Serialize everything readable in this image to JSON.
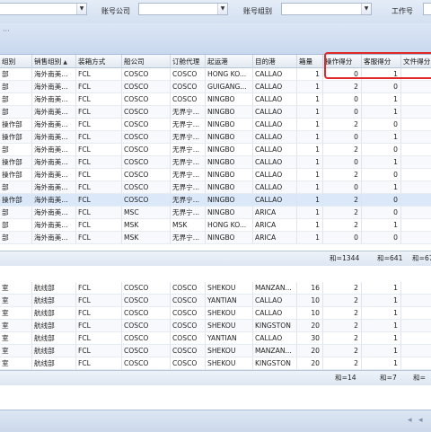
{
  "toolbar": {
    "label_account_company": "账号公司",
    "label_account_group": "账号组别",
    "label_work_no": "工作号",
    "input_values": [
      "",
      "",
      "",
      ""
    ],
    "dropdown_glyph": "▼"
  },
  "top_table": {
    "headers": [
      "组别",
      "销售组别",
      "装箱方式",
      "船公司",
      "订舱代理",
      "起运港",
      "目的港",
      "箱量",
      "操作得分",
      "客服得分",
      "文件得分"
    ],
    "sort_indicator": "▲",
    "rows": [
      [
        "部",
        "海外南美...",
        "FCL",
        "COSCO",
        "COSCO",
        "HONG KO...",
        "CALLAO",
        "1",
        "0",
        "1"
      ],
      [
        "部",
        "海外南美...",
        "FCL",
        "COSCO",
        "COSCO",
        "GUIGANG...",
        "CALLAO",
        "1",
        "2",
        "0"
      ],
      [
        "部",
        "海外南美...",
        "FCL",
        "COSCO",
        "COSCO",
        "NINGBO",
        "CALLAO",
        "1",
        "0",
        "1"
      ],
      [
        "部",
        "海外南美...",
        "FCL",
        "COSCO",
        "无界宁...",
        "NINGBO",
        "CALLAO",
        "1",
        "0",
        "1"
      ],
      [
        "操作部",
        "海外南美...",
        "FCL",
        "COSCO",
        "无界宁...",
        "NINGBO",
        "CALLAO",
        "1",
        "2",
        "0"
      ],
      [
        "操作部",
        "海外南美...",
        "FCL",
        "COSCO",
        "无界宁...",
        "NINGBO",
        "CALLAO",
        "1",
        "0",
        "1"
      ],
      [
        "部",
        "海外南美...",
        "FCL",
        "COSCO",
        "无界宁...",
        "NINGBO",
        "CALLAO",
        "1",
        "2",
        "0"
      ],
      [
        "操作部",
        "海外南美...",
        "FCL",
        "COSCO",
        "无界宁...",
        "NINGBO",
        "CALLAO",
        "1",
        "0",
        "1"
      ],
      [
        "操作部",
        "海外南美...",
        "FCL",
        "COSCO",
        "无界宁...",
        "NINGBO",
        "CALLAO",
        "1",
        "2",
        "0"
      ],
      [
        "部",
        "海外南美...",
        "FCL",
        "COSCO",
        "无界宁...",
        "NINGBO",
        "CALLAO",
        "1",
        "0",
        "1"
      ],
      [
        "操作部",
        "海外南美...",
        "FCL",
        "COSCO",
        "无界宁...",
        "NINGBO",
        "CALLAO",
        "1",
        "2",
        "0"
      ],
      [
        "部",
        "海外南美...",
        "FCL",
        "MSC",
        "无界宁...",
        "NINGBO",
        "ARICA",
        "1",
        "2",
        "0"
      ],
      [
        "部",
        "海外南美...",
        "FCL",
        "MSK",
        "MSK",
        "HONG KO...",
        "ARICA",
        "1",
        "2",
        "1"
      ],
      [
        "部",
        "海外南美...",
        "FCL",
        "MSK",
        "无界宁...",
        "NINGBO",
        "ARICA",
        "1",
        "0",
        "0"
      ]
    ],
    "sums": [
      "和=1344",
      "和=641",
      "和=67"
    ]
  },
  "bottom_table": {
    "rows": [
      [
        "室",
        "航线部",
        "FCL",
        "COSCO",
        "COSCO",
        "SHEKOU",
        "MANZAN...",
        "16",
        "2",
        "1"
      ],
      [
        "室",
        "航线部",
        "FCL",
        "COSCO",
        "COSCO",
        "YANTIAN",
        "CALLAO",
        "10",
        "2",
        "1"
      ],
      [
        "室",
        "航线部",
        "FCL",
        "COSCO",
        "COSCO",
        "SHEKOU",
        "CALLAO",
        "10",
        "2",
        "1"
      ],
      [
        "室",
        "航线部",
        "FCL",
        "COSCO",
        "COSCO",
        "SHEKOU",
        "KINGSTON",
        "20",
        "2",
        "1"
      ],
      [
        "室",
        "航线部",
        "FCL",
        "COSCO",
        "COSCO",
        "YANTIAN",
        "CALLAO",
        "30",
        "2",
        "1"
      ],
      [
        "室",
        "航线部",
        "FCL",
        "COSCO",
        "COSCO",
        "SHEKOU",
        "MANZAN...",
        "20",
        "2",
        "1"
      ],
      [
        "室",
        "航线部",
        "FCL",
        "COSCO",
        "COSCO",
        "SHEKOU",
        "KINGSTON",
        "20",
        "2",
        "1"
      ]
    ],
    "sums": [
      "和=14",
      "和=7",
      "和="
    ]
  },
  "pager": {
    "first": "◂",
    "prev": "◂",
    "scroll_left": "◂",
    "scroll_right": "▸"
  },
  "colors": {
    "highlight_box": "#e02828",
    "header_bg": "#e3e9f2",
    "selected_row": "#dbe8fa"
  }
}
